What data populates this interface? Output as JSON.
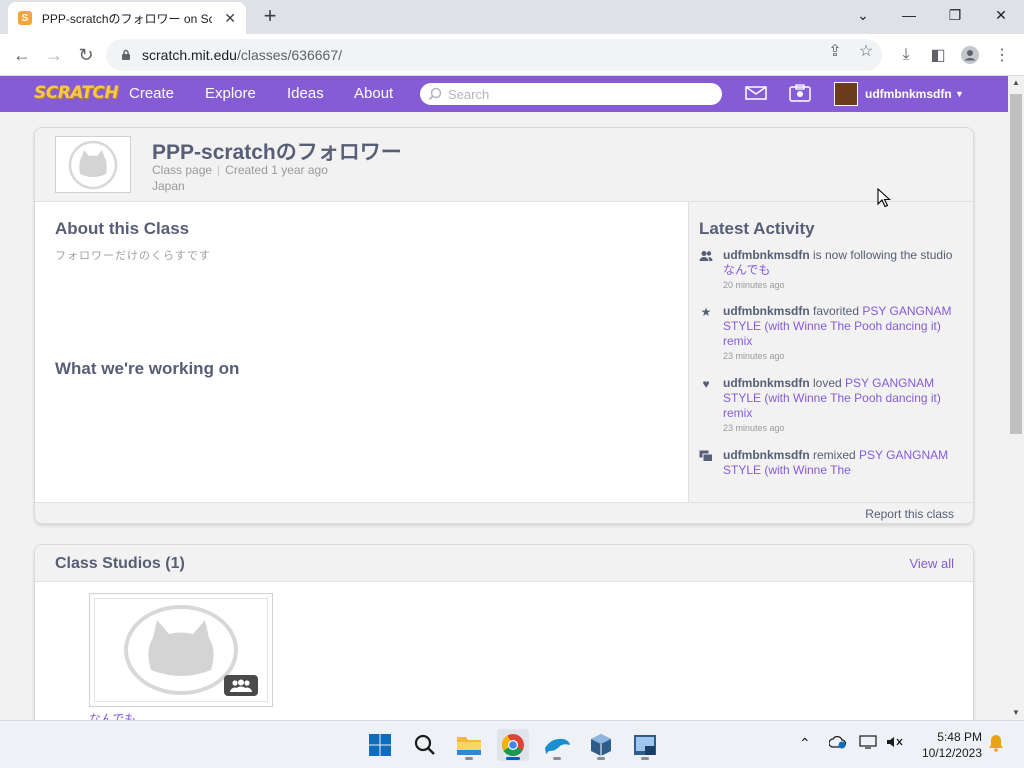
{
  "browser": {
    "tab_title": "PPP-scratchのフォロワー on Scratch",
    "tab_favicon_letter": "S",
    "url_host": "scratch.mit.edu",
    "url_path": "/classes/636667/"
  },
  "scratch_nav": {
    "logo": "SCRATCH",
    "links": [
      "Create",
      "Explore",
      "Ideas",
      "About"
    ],
    "search_placeholder": "Search",
    "username": "udfmbnkmsdfn",
    "accent_color": "#855cd6"
  },
  "class": {
    "title": "PPP-scratchのフォロワー",
    "type": "Class page",
    "created": "Created 1 year ago",
    "country": "Japan"
  },
  "about": {
    "title": "About this Class",
    "description": "フォロワーだけのくらすです"
  },
  "working_on": {
    "title": "What we're working on"
  },
  "latest_activity": {
    "title": "Latest Activity",
    "items": [
      {
        "icon": "followers-icon",
        "user": "udfmbnkmsdfn",
        "action": " is now following the studio ",
        "target": "なんでも",
        "time": "20 minutes ago"
      },
      {
        "icon": "star-icon",
        "user": "udfmbnkmsdfn",
        "action": " favorited ",
        "target": "PSY GANGNAM STYLE (with Winne The Pooh dancing it) remix",
        "time": "23 minutes ago"
      },
      {
        "icon": "heart-icon",
        "user": "udfmbnkmsdfn",
        "action": " loved ",
        "target": "PSY GANGNAM STYLE (with Winne The Pooh dancing it) remix",
        "time": "23 minutes ago"
      },
      {
        "icon": "remix-icon",
        "user": "udfmbnkmsdfn",
        "action": " remixed ",
        "target": "PSY GANGNAM STYLE (with Winne The",
        "time": ""
      }
    ]
  },
  "report_label": "Report this class",
  "studios": {
    "title": "Class Studios (1)",
    "view_all": "View all",
    "items": [
      {
        "name": "なんでも"
      }
    ]
  },
  "taskbar": {
    "time": "5:48 PM",
    "date": "10/12/2023"
  }
}
